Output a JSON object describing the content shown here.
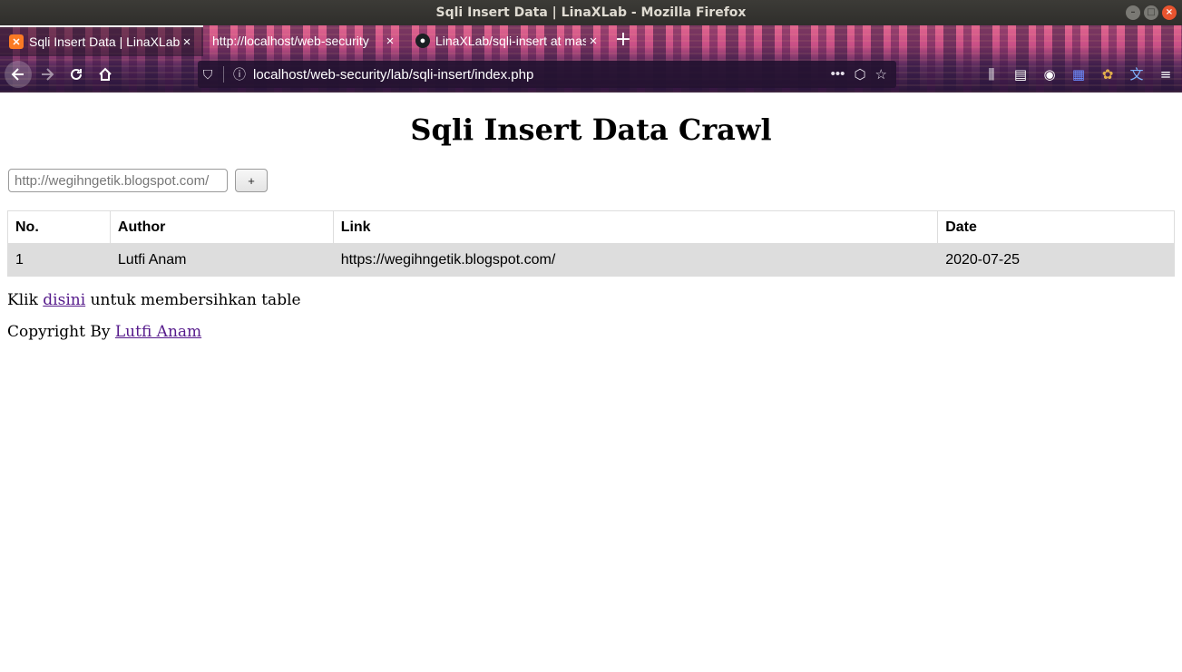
{
  "window": {
    "title": "Sqli Insert Data | LinaXLab - Mozilla Firefox",
    "minimize": "–",
    "maximize": "□",
    "close": "×"
  },
  "tabs": [
    {
      "label": "Sqli Insert Data | LinaXLab",
      "favicon": "xampp-icon",
      "active": true
    },
    {
      "label": "http://localhost/web-security",
      "favicon": "",
      "active": false
    },
    {
      "label": "LinaXLab/sqli-insert at master",
      "favicon": "github-icon",
      "active": false
    }
  ],
  "tab_close_glyph": "×",
  "new_tab_glyph": "+",
  "navbar": {
    "url": "localhost/web-security/lab/sqli-insert/index.php",
    "icons": [
      "back-icon",
      "forward-icon",
      "reload-icon",
      "home-icon",
      "shield-icon",
      "info-icon",
      "page-actions-icon",
      "pocket-icon",
      "bookmark-star-icon",
      "library-icon",
      "sidebar-icon",
      "account-icon",
      "extension-icon",
      "cookie-icon",
      "translate-icon",
      "menu-icon"
    ]
  },
  "page": {
    "heading": "Sqli Insert Data Crawl",
    "input_placeholder": "http://wegihngetik.blogspot.com/",
    "add_button": "+",
    "table": {
      "headers": [
        "No.",
        "Author",
        "Link",
        "Date"
      ],
      "rows": [
        [
          "1",
          "Lutfi Anam",
          "https://wegihngetik.blogspot.com/",
          "2020-07-25"
        ]
      ]
    },
    "clear_prefix": "Klik",
    "clear_link": "disini",
    "clear_suffix": "untuk membersihkan table",
    "copyright_prefix": "Copyright By",
    "copyright_link": "Lutfi Anam"
  },
  "colors": {
    "link_visited": "#551a8b",
    "row_bg": "#dddddd",
    "close_button": "#e9542f"
  }
}
